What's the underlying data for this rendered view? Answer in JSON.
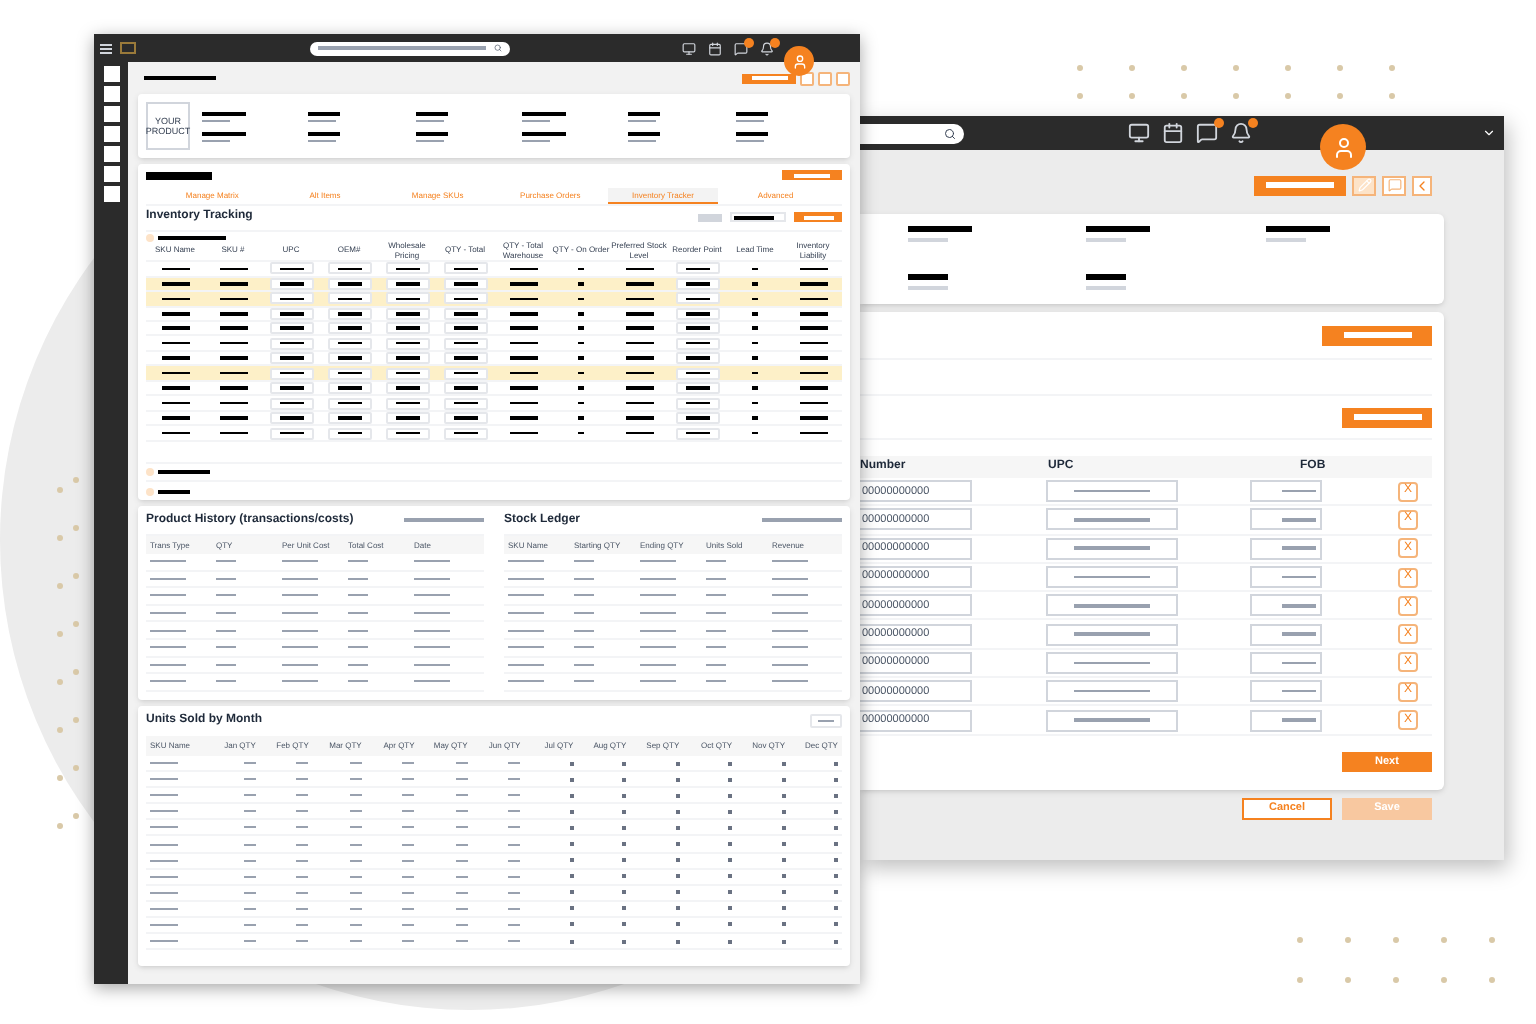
{
  "front": {
    "logo": "YOUR PRODUCT",
    "tabs": [
      {
        "label": "Manage Matrix",
        "selected": false
      },
      {
        "label": "Alt Items",
        "selected": false
      },
      {
        "label": "Manage SKUs",
        "selected": false
      },
      {
        "label": "Purchase Orders",
        "selected": false
      },
      {
        "label": "Inventory Tracker",
        "selected": true
      },
      {
        "label": "Advanced",
        "selected": false
      }
    ],
    "section_title": "Inventory Tracking",
    "inventory_table": {
      "columns": [
        {
          "label": "SKU Name",
          "kind": "text"
        },
        {
          "label": "SKU #",
          "kind": "text"
        },
        {
          "label": "UPC",
          "kind": "input"
        },
        {
          "label": "OEM#",
          "kind": "input"
        },
        {
          "label": "Wholesale Pricing",
          "kind": "input"
        },
        {
          "label": "QTY - Total",
          "kind": "input"
        },
        {
          "label": "QTY - Total Warehouse",
          "kind": "text"
        },
        {
          "label": "QTY - On Order",
          "kind": "dot"
        },
        {
          "label": "Preferred Stock Level",
          "kind": "text"
        },
        {
          "label": "Reorder Point",
          "kind": "input"
        },
        {
          "label": "Lead Time",
          "kind": "dot"
        },
        {
          "label": "Inventory Liability",
          "kind": "text"
        }
      ],
      "rows": [
        {
          "highlighted": false
        },
        {
          "highlighted": true
        },
        {
          "highlighted": true
        },
        {
          "highlighted": false
        },
        {
          "highlighted": false
        },
        {
          "highlighted": false
        },
        {
          "highlighted": false
        },
        {
          "highlighted": true
        },
        {
          "highlighted": false
        },
        {
          "highlighted": false
        },
        {
          "highlighted": false
        },
        {
          "highlighted": false
        }
      ]
    },
    "history": {
      "title": "Product History (transactions/costs)",
      "columns": [
        "Trans Type",
        "QTY",
        "Per Unit Cost",
        "Total Cost",
        "Date"
      ]
    },
    "ledger": {
      "title": "Stock Ledger",
      "columns": [
        "SKU Name",
        "Starting QTY",
        "Ending QTY",
        "Units Sold",
        "Revenue"
      ]
    },
    "units": {
      "title": "Units Sold by Month",
      "columns": [
        {
          "label": "SKU Name",
          "kind": "name"
        },
        {
          "label": "Jan QTY",
          "kind": "filled"
        },
        {
          "label": "Feb QTY",
          "kind": "filled"
        },
        {
          "label": "Mar QTY",
          "kind": "filled"
        },
        {
          "label": "Apr QTY",
          "kind": "filled"
        },
        {
          "label": "May QTY",
          "kind": "filled"
        },
        {
          "label": "Jun QTY",
          "kind": "filled"
        },
        {
          "label": "Jul QTY",
          "kind": "empty"
        },
        {
          "label": "Aug QTY",
          "kind": "empty"
        },
        {
          "label": "Sep QTY",
          "kind": "empty"
        },
        {
          "label": "Oct QTY",
          "kind": "empty"
        },
        {
          "label": "Nov QTY",
          "kind": "empty"
        },
        {
          "label": "Dec QTY",
          "kind": "empty"
        }
      ]
    }
  },
  "back": {
    "columns": [
      "Number",
      "UPC",
      "FOB"
    ],
    "rows": [
      {
        "number": "00000000000",
        "remove": "X"
      },
      {
        "number": "00000000000",
        "remove": "X"
      },
      {
        "number": "00000000000",
        "remove": "X"
      },
      {
        "number": "00000000000",
        "remove": "X"
      },
      {
        "number": "00000000000",
        "remove": "X"
      },
      {
        "number": "00000000000",
        "remove": "X"
      },
      {
        "number": "00000000000",
        "remove": "X"
      },
      {
        "number": "00000000000",
        "remove": "X"
      },
      {
        "number": "00000000000",
        "remove": "X"
      }
    ],
    "next": "Next",
    "cancel": "Cancel",
    "save": {
      "label": "Save",
      "disabled": true
    }
  }
}
